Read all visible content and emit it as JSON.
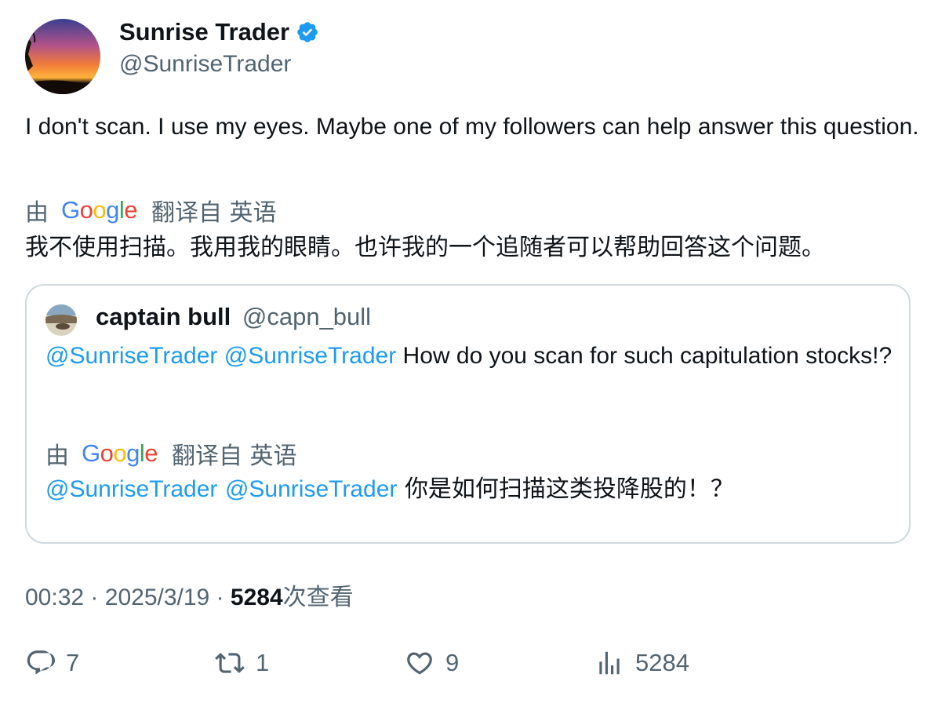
{
  "author": {
    "name": "Sunrise Trader",
    "handle": "@SunriseTrader",
    "verified": true
  },
  "tweet": {
    "text": "I don't scan.  I use my eyes.  Maybe one of my followers can help answer this question.",
    "translation": {
      "by": "由",
      "provider": "Google",
      "from": "翻译自 英语",
      "text": "我不使用扫描。我用我的眼睛。也许我的一个追随者可以帮助回答这个问题。"
    }
  },
  "quoted": {
    "name": "captain bull",
    "handle": "@capn_bull",
    "mention1": "@SunriseTrader",
    "mention2": "@SunriseTrader",
    "text": "How do you scan for such capitulation stocks!?",
    "translation": {
      "by": "由",
      "provider": "Google",
      "from": "翻译自 英语",
      "text": "你是如何扫描这类投降股的！？"
    }
  },
  "meta": {
    "time": "00:32",
    "sep": "·",
    "date": "2025/3/19",
    "views": "5284",
    "views_label": "次查看"
  },
  "actions": {
    "replies": "7",
    "retweets": "1",
    "likes": "9",
    "views": "5284"
  },
  "colors": {
    "link": "#1d9bf0",
    "secondary": "#536471",
    "primary": "#0f1419",
    "border": "#cfd9de"
  }
}
